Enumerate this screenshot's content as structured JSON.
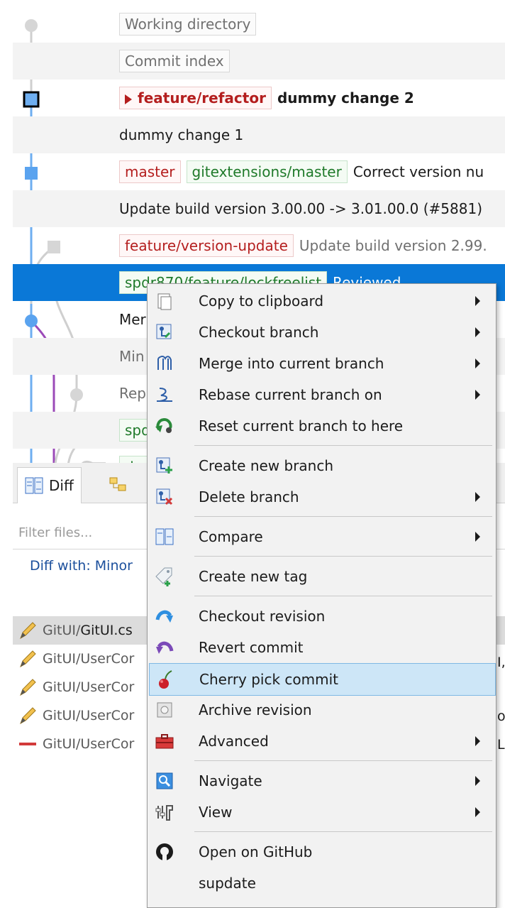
{
  "graph": {
    "rows": [
      {
        "kind": "tags",
        "tags": [
          {
            "text": "Working directory",
            "style": "gray"
          }
        ],
        "message": ""
      },
      {
        "kind": "tags",
        "tags": [
          {
            "text": "Commit index",
            "style": "gray"
          }
        ],
        "message": ""
      },
      {
        "kind": "head",
        "tags": [
          {
            "text": "feature/refactor",
            "style": "redbold"
          }
        ],
        "message": "dummy change 2",
        "msgstyle": "bold"
      },
      {
        "kind": "msg",
        "tags": [],
        "message": "dummy change 1"
      },
      {
        "kind": "tags",
        "tags": [
          {
            "text": "master",
            "style": "red"
          },
          {
            "text": "gitextensions/master",
            "style": "green"
          }
        ],
        "message": "Correct version nu"
      },
      {
        "kind": "msg",
        "tags": [],
        "message": "Update build version 3.00.00 -> 3.01.00.0 (#5881)"
      },
      {
        "kind": "tags",
        "tags": [
          {
            "text": "feature/version-update",
            "style": "red"
          }
        ],
        "message": "Update build version 2.99.",
        "msgstyle": "gray"
      },
      {
        "kind": "selected",
        "tags": [
          {
            "text": "spdr870/feature/lockfreelist",
            "style": "green"
          }
        ],
        "message": "Reviewed"
      },
      {
        "kind": "msg",
        "tags": [],
        "message": "Mer"
      },
      {
        "kind": "msg",
        "tags": [],
        "message": "Min",
        "msgstyle": "gray"
      },
      {
        "kind": "msg",
        "tags": [],
        "message": "Rep",
        "msgstyle": "gray"
      },
      {
        "kind": "tags",
        "tags": [
          {
            "text": "spd",
            "style": "green"
          }
        ],
        "message": ""
      },
      {
        "kind": "tags",
        "tags": [
          {
            "text": "dre",
            "style": "green"
          }
        ],
        "message": ""
      }
    ]
  },
  "bottom": {
    "tabs": [
      {
        "label": "Diff",
        "icon": "diff-icon"
      },
      {
        "label": "",
        "icon": "file-tree-icon"
      }
    ],
    "filter_placeholder": "Filter files...",
    "diff_with": "Diff with: Minor",
    "files": [
      {
        "prefix": "GitUI/",
        "name": "GitUI.cs",
        "status": "modified"
      },
      {
        "prefix": "GitUI/UserCor",
        "name": "",
        "status": "modified"
      },
      {
        "prefix": "GitUI/UserCor",
        "name": "",
        "status": "modified"
      },
      {
        "prefix": "GitUI/UserCor",
        "name": "",
        "status": "modified"
      },
      {
        "prefix": "GitUI/UserCor",
        "name": "",
        "status": "deleted"
      }
    ]
  },
  "context_menu": {
    "items": [
      {
        "label": "Copy to clipboard",
        "icon": "clipboard-icon",
        "submenu": true
      },
      {
        "label": "Checkout branch",
        "icon": "checkout-branch-icon",
        "submenu": true
      },
      {
        "label": "Merge into current branch",
        "icon": "merge-icon",
        "submenu": true
      },
      {
        "label": "Rebase current branch on",
        "icon": "rebase-icon",
        "submenu": true
      },
      {
        "label": "Reset current branch to here",
        "icon": "reset-icon",
        "submenu": false
      },
      {
        "label": "Create new branch",
        "icon": "create-branch-icon",
        "submenu": false
      },
      {
        "label": "Delete branch",
        "icon": "delete-branch-icon",
        "submenu": true
      },
      {
        "label": "Compare",
        "icon": "compare-icon",
        "submenu": true
      },
      {
        "label": "Create new tag",
        "icon": "tag-add-icon",
        "submenu": false
      },
      {
        "label": "Checkout revision",
        "icon": "checkout-revision-icon",
        "submenu": false
      },
      {
        "label": "Revert commit",
        "icon": "revert-icon",
        "submenu": false
      },
      {
        "label": "Cherry pick commit",
        "icon": "cherry-icon",
        "submenu": false,
        "highlighted": true
      },
      {
        "label": "Archive revision",
        "icon": "archive-icon",
        "submenu": false
      },
      {
        "label": "Advanced",
        "icon": "toolbox-icon",
        "submenu": true
      },
      {
        "label": "Navigate",
        "icon": "navigate-icon",
        "submenu": true
      },
      {
        "label": "View",
        "icon": "view-icon",
        "submenu": true
      },
      {
        "label": "Open on GitHub",
        "icon": "github-icon",
        "submenu": false
      },
      {
        "label": "supdate",
        "icon": "",
        "submenu": false
      }
    ]
  },
  "colors": {
    "selection": "#0a78d7",
    "menu_highlight": "#cde6f7",
    "branch_red": "#b41e1e",
    "branch_green": "#1f7a2a"
  }
}
